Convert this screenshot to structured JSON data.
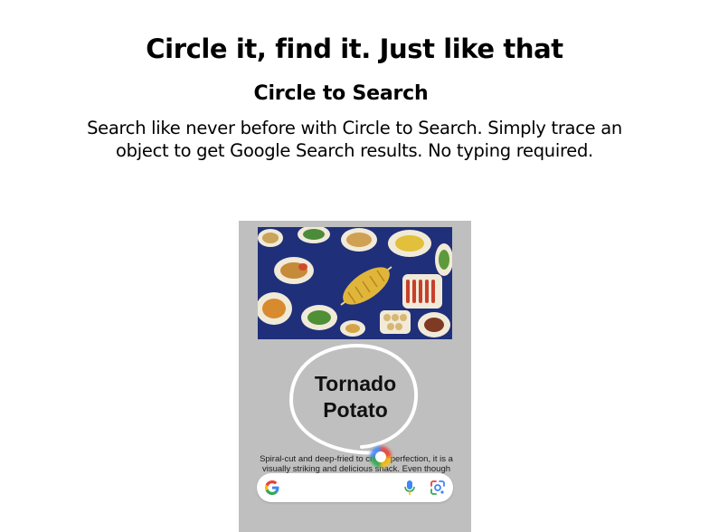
{
  "headline": "Circle it, find it. Just like that",
  "subtitle": "Circle to Search",
  "description": "Search like never before with Circle to Search. Simply trace an object to get Google Search results. No typing required.",
  "phone": {
    "circled_label": "Tornado Potato",
    "snippet_text": "Spiral-cut and deep-fried to crispy perfection, it is a visually striking and delicious snack. Even though",
    "searchbar": {
      "logo_icon": "google-g-icon",
      "mic_icon": "microphone-icon",
      "lens_icon": "google-lens-icon"
    },
    "colors": {
      "screen_bg": "#bfbfbf",
      "photo_bg": "#1f2f7a",
      "google_blue": "#4285f4",
      "google_red": "#ea4335",
      "google_yellow": "#fbbc05",
      "google_green": "#34a853"
    }
  }
}
